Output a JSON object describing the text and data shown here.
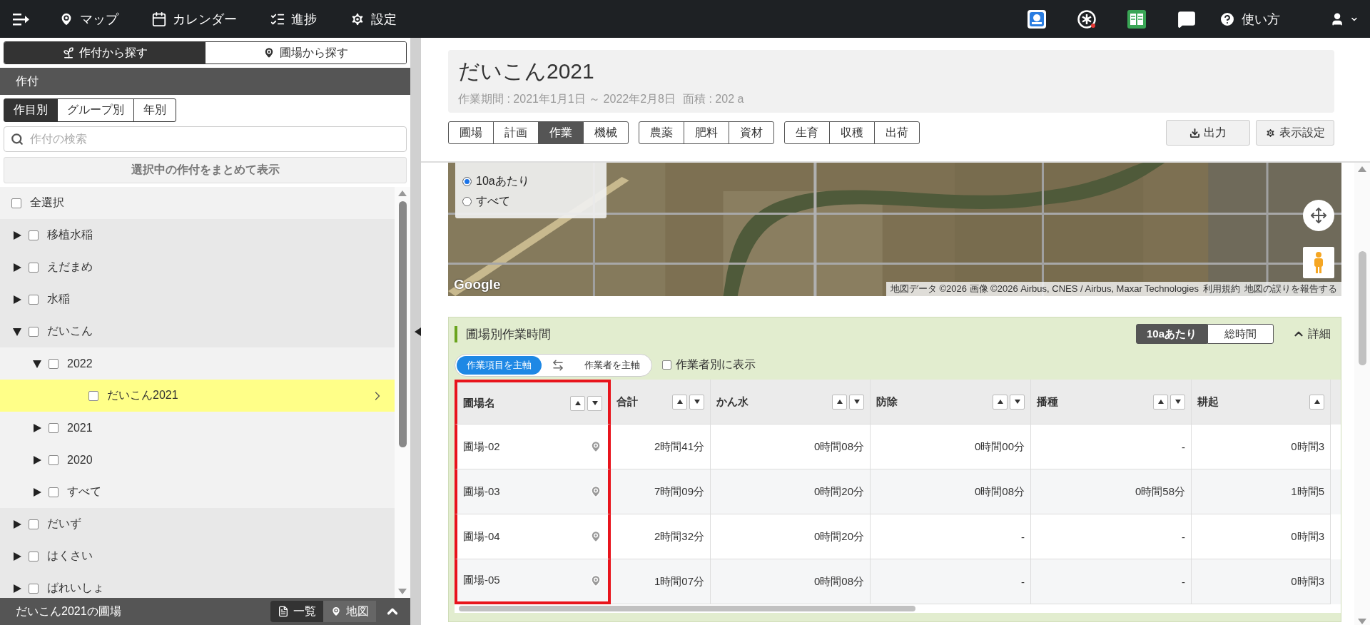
{
  "nav": {
    "items": [
      {
        "label": "マップ",
        "kind": "pin"
      },
      {
        "label": "カレンダー",
        "kind": "calendar"
      },
      {
        "label": "進捗",
        "kind": "progress"
      },
      {
        "label": "設定",
        "kind": "settings"
      }
    ],
    "help": "使い方"
  },
  "sidebar": {
    "search_tabs": [
      {
        "label": "作付から探す",
        "selected": true,
        "kind": "sprout"
      },
      {
        "label": "圃場から探す",
        "selected": false,
        "kind": "pin"
      }
    ],
    "section_title": "作付",
    "view_tabs": [
      {
        "label": "作目別",
        "selected": true
      },
      {
        "label": "グループ別",
        "selected": false
      },
      {
        "label": "年別",
        "selected": false
      }
    ],
    "search": {
      "placeholder": "作付の検索"
    },
    "show_selected_button": "選択中の作付をまとめて表示",
    "select_all": {
      "label": "全選択",
      "checked": false
    },
    "tree": [
      {
        "label": "移植水稲",
        "kind": "folder",
        "expanded": false,
        "checked": false
      },
      {
        "label": "えだまめ",
        "kind": "folder",
        "expanded": false,
        "checked": false
      },
      {
        "label": "水稲",
        "kind": "folder",
        "expanded": false,
        "checked": false
      },
      {
        "label": "だいこん",
        "kind": "folder",
        "expanded": true,
        "checked": false,
        "children": [
          {
            "label": "2022",
            "kind": "folder",
            "expanded": true,
            "checked": false,
            "children": [
              {
                "label": "だいこん2021",
                "kind": "crop",
                "checked": false,
                "selected": true
              }
            ]
          },
          {
            "label": "2021",
            "kind": "folder",
            "expanded": false,
            "checked": false
          },
          {
            "label": "2020",
            "kind": "folder",
            "expanded": false,
            "checked": false
          },
          {
            "label": "すべて",
            "kind": "folder",
            "expanded": false,
            "checked": false
          }
        ]
      },
      {
        "label": "だいず",
        "kind": "folder",
        "expanded": false,
        "checked": false
      },
      {
        "label": "はくさい",
        "kind": "folder",
        "expanded": false,
        "checked": false
      },
      {
        "label": "ばれいしょ",
        "kind": "folder",
        "expanded": false,
        "checked": false
      }
    ],
    "footer": {
      "title": "だいこん2021の圃場",
      "views": [
        {
          "label": "一覧",
          "selected": true,
          "kind": "list"
        },
        {
          "label": "地図",
          "selected": false,
          "kind": "pin"
        }
      ]
    }
  },
  "header": {
    "title": "だいこん2021",
    "period": "作業期間 : 2021年1月1日 ～ 2022年2月8日",
    "area": "面積 : 202 a",
    "tab_groups": [
      {
        "tabs": [
          {
            "label": "圃場",
            "selected": false
          },
          {
            "label": "計画",
            "selected": false
          },
          {
            "label": "作業",
            "selected": true
          },
          {
            "label": "機械",
            "selected": false
          }
        ]
      },
      {
        "tabs": [
          {
            "label": "農薬",
            "selected": false
          },
          {
            "label": "肥料",
            "selected": false
          },
          {
            "label": "資材",
            "selected": false
          }
        ]
      },
      {
        "tabs": [
          {
            "label": "生育",
            "selected": false
          },
          {
            "label": "収穫",
            "selected": false
          },
          {
            "label": "出荷",
            "selected": false
          }
        ]
      }
    ],
    "buttons": [
      {
        "label": "出力",
        "kind": "download"
      },
      {
        "label": "表示設定",
        "kind": "settings"
      }
    ]
  },
  "map": {
    "legend": [
      {
        "label": "10aあたり",
        "selected": true
      },
      {
        "label": "すべて",
        "selected": false
      }
    ],
    "logo": "Google",
    "attribution": "地図データ ©2026 画像 ©2026 Airbus, CNES / Airbus, Maxar Technologies",
    "links": [
      "利用規約",
      "地図の誤りを報告する"
    ]
  },
  "work_time": {
    "title": "圃場別作業時間",
    "unit_toggle": [
      {
        "label": "10aあたり",
        "selected": true
      },
      {
        "label": "総時間",
        "selected": false
      }
    ],
    "detail": {
      "label": "詳細",
      "expanded": true
    },
    "axis_toggle": [
      {
        "label": "作業項目を主軸",
        "selected": true
      },
      {
        "label": "作業者を主軸",
        "selected": false
      }
    ],
    "by_worker": {
      "label": "作業者別に表示",
      "checked": false
    },
    "columns": [
      {
        "label": "圃場名",
        "highlighted": true
      },
      {
        "label": "合計",
        "highlighted": false
      },
      {
        "label": "かん水",
        "highlighted": false
      },
      {
        "label": "防除",
        "highlighted": false
      },
      {
        "label": "播種",
        "highlighted": false
      },
      {
        "label": "耕起",
        "highlighted": false
      }
    ],
    "rows": [
      {
        "field": "圃場-02",
        "values": [
          "2時間41分",
          "0時間08分",
          "0時間00分",
          "-",
          "0時間3"
        ]
      },
      {
        "field": "圃場-03",
        "values": [
          "7時間09分",
          "0時間20分",
          "0時間08分",
          "0時間58分",
          "1時間5"
        ]
      },
      {
        "field": "圃場-04",
        "values": [
          "2時間32分",
          "0時間20分",
          "-",
          "-",
          "0時間3"
        ]
      },
      {
        "field": "圃場-05",
        "values": [
          "1時間07分",
          "0時間08分",
          "-",
          "-",
          "0時間3"
        ]
      }
    ]
  }
}
